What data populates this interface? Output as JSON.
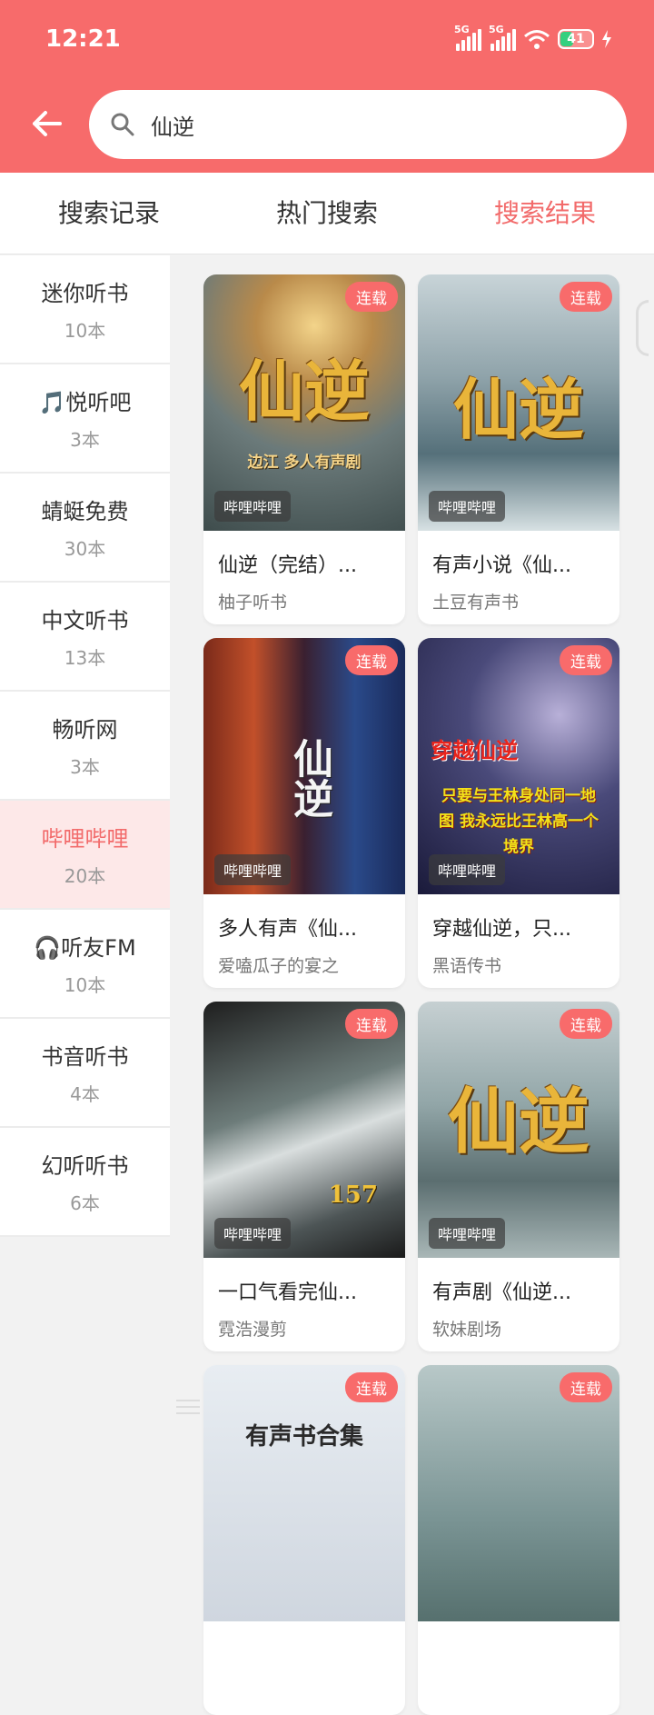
{
  "status": {
    "time": "12:21",
    "signal1": "5G",
    "signal2": "5G",
    "battery": "41"
  },
  "search": {
    "query": "仙逆",
    "placeholder": ""
  },
  "tabs": [
    {
      "label": "搜索记录",
      "active": false
    },
    {
      "label": "热门搜索",
      "active": false
    },
    {
      "label": "搜索结果",
      "active": true
    }
  ],
  "sidebar": {
    "items": [
      {
        "name": "迷你听书",
        "count": "10本"
      },
      {
        "name": "🎵悦听吧",
        "count": "3本"
      },
      {
        "name": "蜻蜓免费",
        "count": "30本"
      },
      {
        "name": "中文听书",
        "count": "13本"
      },
      {
        "name": "畅听网",
        "count": "3本"
      },
      {
        "name": "哔哩哔哩",
        "count": "20本",
        "active": true
      },
      {
        "name": "🎧听友FM",
        "count": "10本"
      },
      {
        "name": "书音听书",
        "count": "4本"
      },
      {
        "name": "幻听听书",
        "count": "6本"
      }
    ]
  },
  "results": [
    {
      "title": "仙逆（完结）...",
      "author": "柚子听书",
      "badge": "连载",
      "source": "哔哩哔哩",
      "cover_text": "仙逆",
      "cover_sub": "边江 多人有声剧"
    },
    {
      "title": "有声小说《仙...",
      "author": "土豆有声书",
      "badge": "连载",
      "source": "哔哩哔哩",
      "cover_text": "仙逆",
      "cover_sub": ""
    },
    {
      "title": "多人有声《仙...",
      "author": "爱嗑瓜子的宴之",
      "badge": "连载",
      "source": "哔哩哔哩",
      "cover_text": "仙逆",
      "cover_sub": ""
    },
    {
      "title": "穿越仙逆，只...",
      "author": "黑语传书",
      "badge": "连载",
      "source": "哔哩哔哩",
      "cover_text": "穿越仙逆",
      "cover_sub": "只要与王林身处同一地图 我永远比王林高一个境界"
    },
    {
      "title": "一口气看完仙...",
      "author": "霓浩漫剪",
      "badge": "连载",
      "source": "哔哩哔哩",
      "cover_text": "157",
      "cover_sub": ""
    },
    {
      "title": "有声剧《仙逆...",
      "author": "软妹剧场",
      "badge": "连载",
      "source": "哔哩哔哩",
      "cover_text": "仙逆",
      "cover_sub": ""
    },
    {
      "title": "",
      "author": "",
      "badge": "连载",
      "source": "",
      "cover_text": "有声书合集",
      "cover_sub": ""
    },
    {
      "title": "",
      "author": "",
      "badge": "连载",
      "source": "",
      "cover_text": "",
      "cover_sub": ""
    }
  ]
}
